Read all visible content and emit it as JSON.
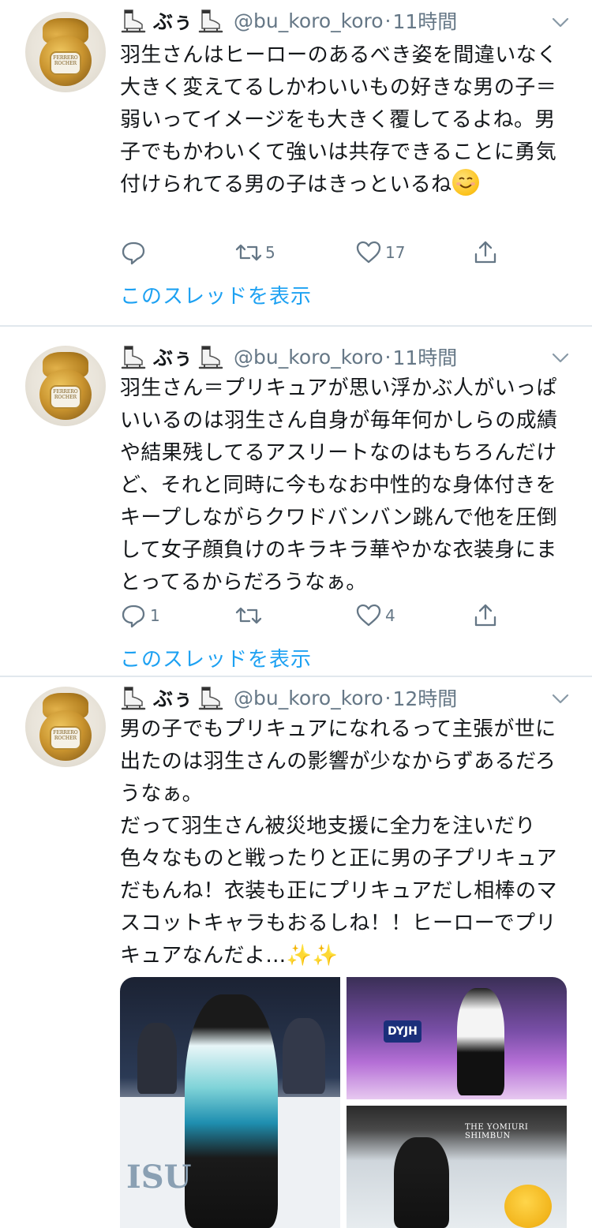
{
  "tweets": [
    {
      "display_name": "ぶぅ",
      "handle": "@bu_koro_koro",
      "separator": "·",
      "time": "11時間",
      "text": "羽生さんはヒーローのあるべき姿を間違いなく大きく変えてるしかわいいもの好きな男の子＝弱いってイメージをも大きく覆してるよね。男子でもかわいくて強いは共存できることに勇気付けられてる男の子はきっといるね",
      "emoji": "smiling-face-emoji",
      "reply_count": "",
      "retweet_count": "5",
      "like_count": "17",
      "thread_link": "このスレッドを表示"
    },
    {
      "display_name": "ぶぅ",
      "handle": "@bu_koro_koro",
      "separator": "·",
      "time": "11時間",
      "text": "羽生さん＝プリキュアが思い浮かぶ人がいっぱいいるのは羽生さん自身が毎年何かしらの成績や結果残してるアスリートなのはもちろんだけど、それと同時に今もなお中性的な身体付きをキープしながらクワドバンバン跳んで他を圧倒して女子顔負けのキラキラ華やかな衣装身にまとってるからだろうなぁ。",
      "reply_count": "1",
      "retweet_count": "",
      "like_count": "4",
      "thread_link": "このスレッドを表示"
    },
    {
      "display_name": "ぶぅ",
      "handle": "@bu_koro_koro",
      "separator": "·",
      "time": "12時間",
      "text": "男の子でもプリキュアになれるって主張が世に出たのは羽生さんの影響が少なからずあるだろうなぁ。\nだって羽生さん被災地支援に全力を注いだり色々なものと戦ったりと正に男の子プリキュアだもんね！衣装も正にプリキュアだし相棒のマスコットキャラもおるしね！！ヒーローでプリキュアなんだよ…✨✨",
      "media": {
        "isu_text": "ISU",
        "banner_text": "DYJH",
        "watermark": "THE YOMIURI SHIMBUN"
      }
    }
  ],
  "avatar_label": "FERRERO ROCHER",
  "colors": {
    "link": "#1da1f2",
    "muted": "#657786",
    "text": "#14171a",
    "divider": "#e1e8ed"
  }
}
